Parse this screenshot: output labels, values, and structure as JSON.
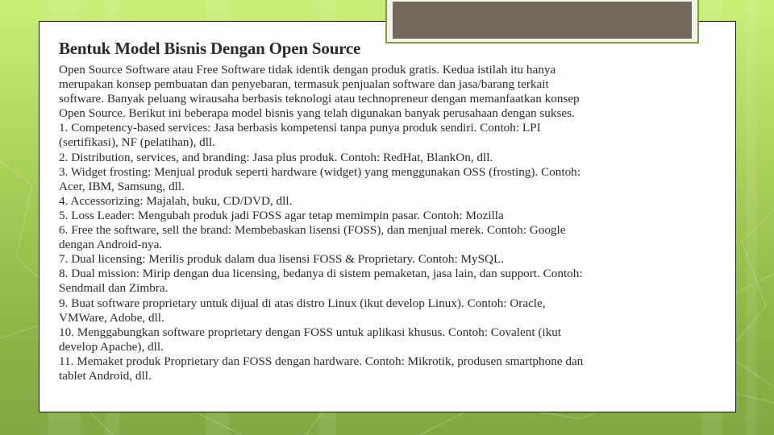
{
  "slide": {
    "title": "Bentuk Model Bisnis Dengan Open Source",
    "colors": {
      "background_top": "#c9ef78",
      "background_bottom": "#82a843",
      "panel": "#ffffff",
      "title_box_fill": "#72695b",
      "title_box_border": "#7ea23a",
      "text": "#2e2a25"
    },
    "body_lines": [
      "Open Source Software atau Free Software tidak identik dengan produk gratis. Kedua istilah itu hanya",
      "merupakan konsep pembuatan dan penyebaran, termasuk penjualan software dan jasa/barang terkait",
      "software. Banyak peluang wirausaha berbasis teknologi atau technopreneur dengan memanfaatkan konsep",
      "Open Source. Berikut ini beberapa model bisnis yang telah digunakan banyak perusahaan dengan sukses.",
      "1. Competency-based services: Jasa berbasis kompetensi tanpa punya produk sendiri. Contoh: LPI",
      "(sertifikasi), NF (pelatihan), dll.",
      "2. Distribution, services, and branding: Jasa plus produk. Contoh: RedHat, BlankOn, dll.",
      "3. Widget frosting: Menjual produk seperti hardware (widget) yang menggunakan OSS (frosting). Contoh:",
      "Acer, IBM, Samsung, dll.",
      "4. Accessorizing: Majalah, buku, CD/DVD, dll.",
      "5. Loss Leader: Mengubah produk jadi FOSS agar tetap memimpin pasar. Contoh: Mozilla",
      "6. Free the software, sell the brand: Membebaskan lisensi (FOSS), dan menjual merek. Contoh: Google",
      "dengan Android-nya.",
      "7. Dual licensing: Merilis produk dalam dua lisensi FOSS & Proprietary. Contoh: MySQL.",
      "8. Dual mission: Mirip dengan dua licensing, bedanya di sistem pemaketan, jasa lain, dan support. Contoh:",
      "Sendmail dan Zimbra.",
      "9. Buat software proprietary untuk dijual di atas distro Linux (ikut develop Linux). Contoh: Oracle,",
      "VMWare, Adobe, dll.",
      "10. Menggabungkan software proprietary dengan FOSS untuk aplikasi khusus. Contoh: Covalent (ikut",
      "develop Apache), dll.",
      "11. Memaket produk Proprietary dan FOSS dengan hardware. Contoh: Mikrotik, produsen smartphone dan",
      "tablet Android, dll."
    ]
  }
}
